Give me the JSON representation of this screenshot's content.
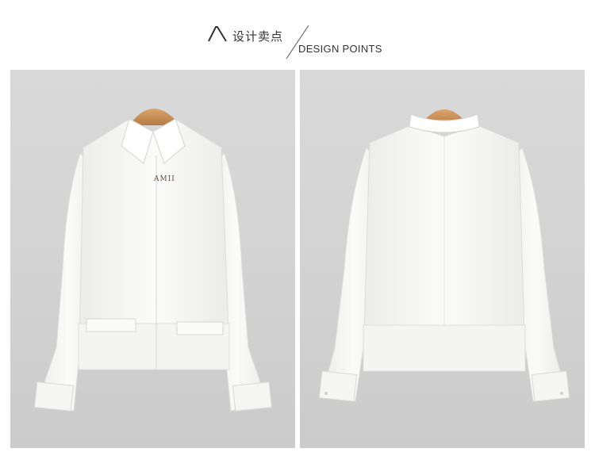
{
  "header": {
    "logo_icon": "amii-chevron-logo-icon",
    "title_cn": "设计卖点",
    "title_en": "DESIGN POINTS"
  },
  "photos": {
    "front": {
      "hanger_brand": "AMII",
      "garment": "white long-sleeve shirt, front view"
    },
    "back": {
      "garment": "white long-sleeve shirt, back view"
    }
  },
  "colors": {
    "photo_background": "#d5d5d5",
    "hanger_wood": "#c8925a",
    "shirt": "#f7f7f5",
    "text": "#333333"
  }
}
